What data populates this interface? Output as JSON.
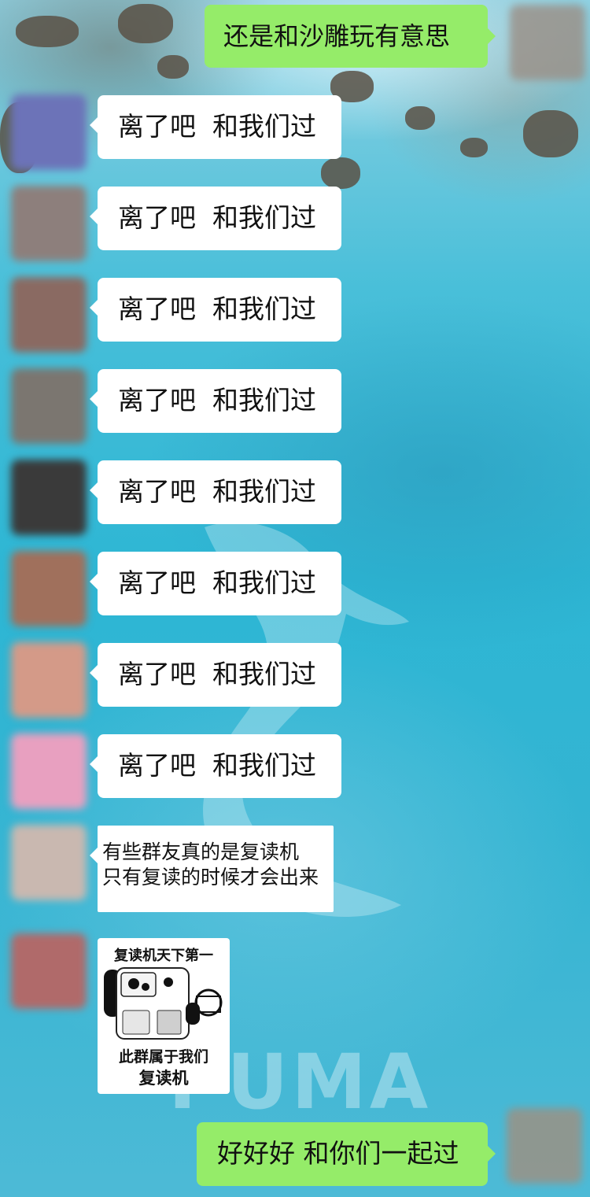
{
  "chat": {
    "messages": [
      {
        "side": "sent",
        "text": "还是和沙雕玩有意思"
      },
      {
        "side": "received",
        "text": "离了吧  和我们过"
      },
      {
        "side": "received",
        "text": "离了吧  和我们过"
      },
      {
        "side": "received",
        "text": "离了吧  和我们过"
      },
      {
        "side": "received",
        "text": "离了吧  和我们过"
      },
      {
        "side": "received",
        "text": "离了吧  和我们过"
      },
      {
        "side": "received",
        "text": "离了吧  和我们过"
      },
      {
        "side": "received",
        "text": "离了吧  和我们过"
      },
      {
        "side": "received",
        "text": "离了吧  和我们过"
      },
      {
        "side": "received",
        "text": "有些群友真的是复读机\n只有复读的时候才会出来"
      },
      {
        "side": "received",
        "sticker": {
          "top": "复读机天下第一",
          "bottom_line1": "此群属于我们",
          "bottom_line2": "复读机"
        }
      },
      {
        "side": "sent",
        "text": "好好好 和你们一起过"
      }
    ]
  },
  "background": {
    "watermark": "PUMA"
  },
  "colors": {
    "sent_bubble": "#95ec69",
    "received_bubble": "#ffffff"
  }
}
